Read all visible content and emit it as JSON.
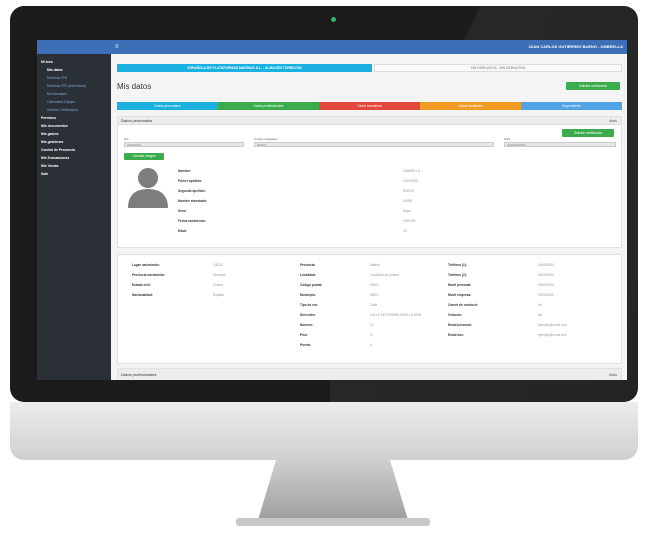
{
  "header": {
    "user": "JUAN CARLOS GUTIÉRREZ BUENO - UMBRELLA"
  },
  "sidebar": {
    "items": [
      {
        "label": "Mi área",
        "type": "head"
      },
      {
        "label": "Mis datos",
        "type": "active"
      },
      {
        "label": "Nóminas IRS",
        "type": "sub"
      },
      {
        "label": "Nóminas IRS (Administra)",
        "type": "sub"
      },
      {
        "label": "Mi calendario",
        "type": "sub"
      },
      {
        "label": "Calendario Equipo",
        "type": "sub"
      },
      {
        "label": "Solicitar Certificados",
        "type": "sub"
      },
      {
        "label": "Permisos",
        "type": "head"
      },
      {
        "label": "Mis documentos",
        "type": "head"
      },
      {
        "label": "Mis gastos",
        "type": "head"
      },
      {
        "label": "Mis gestiones",
        "type": "head"
      },
      {
        "label": "Control de Presencia",
        "type": "head"
      },
      {
        "label": "Mis Evaluaciones",
        "type": "head"
      },
      {
        "label": "Mis Ventas",
        "type": "head"
      },
      {
        "label": "Salir",
        "type": "head"
      }
    ]
  },
  "main": {
    "company": "ESPAÑOLA DE PLATAFORMAS MARINAS S.L. - ALMACÉN TORREJÓN",
    "company_alt": "SIN DERIVATIVA - SIN DERIVATIVA",
    "title": "Mis datos",
    "cert_button": "Solicitar certificados",
    "tabs": [
      {
        "label": "Datos personales",
        "color": "#1ab0e0"
      },
      {
        "label": "Datos profesionales",
        "color": "#3aac4e"
      },
      {
        "label": "Datos bancarios",
        "color": "#e4473b"
      },
      {
        "label": "Datos familiares",
        "color": "#f39c24"
      },
      {
        "label": "Seguimiento",
        "color": "#4fa3e6"
      }
    ],
    "panel1": {
      "title": "Datos personales",
      "back": "Atrás",
      "cert_button": "Solicitar certificados",
      "nif_label": "NIF",
      "nif_value": "00000000Z",
      "code_label": "Código trabajador",
      "code_value": "000000",
      "ss_label": "NSS",
      "ss_value": "000000000000",
      "change_image": "Cambiar imagen",
      "fields": [
        {
          "k": "Nombre:",
          "v": "UMBRELLA"
        },
        {
          "k": "Primer apellido:",
          "v": "CASTAÑO"
        },
        {
          "k": "Segundo apellido:",
          "v": "BUENO"
        },
        {
          "k": "Nombre abreviado:",
          "v": "UMBR"
        },
        {
          "k": "Sexo:",
          "v": "Mujer"
        },
        {
          "k": "Fecha nacimiento:",
          "v": "00/00/00"
        },
        {
          "k": "Edad:",
          "v": "43"
        }
      ]
    },
    "details": {
      "col1": [
        {
          "k": "Lugar nacimiento:",
          "v": "CÁDIZ"
        },
        {
          "k": "Provincia nacimiento:",
          "v": "Granada"
        },
        {
          "k": "Estado civil:",
          "v": "Soltera"
        },
        {
          "k": "Nacionalidad:",
          "v": "España"
        }
      ],
      "col2": [
        {
          "k": "Provincia:",
          "v": "Madrid"
        },
        {
          "k": "Localidad:",
          "v": "Localidad de prueba"
        },
        {
          "k": "Código postal:",
          "v": "28001"
        },
        {
          "k": "Municipio:",
          "v": "28001"
        },
        {
          "k": "Tipo de vía:",
          "v": "Calle"
        },
        {
          "k": "Dirección:",
          "v": "CALLE DE PRUEBA PARA LA WEB"
        },
        {
          "k": "Número:",
          "v": "11"
        },
        {
          "k": "Piso:",
          "v": "11"
        },
        {
          "k": "Puerta:",
          "v": "A"
        }
      ],
      "col3": [
        {
          "k": "Teléfono (1):",
          "v": "000000000"
        },
        {
          "k": "Teléfono (2):",
          "v": "000000000"
        },
        {
          "k": "Movil personal:",
          "v": "000000000"
        },
        {
          "k": "Movil empresa:",
          "v": "000000000"
        },
        {
          "k": "Carnet de conducir:",
          "v": "No"
        },
        {
          "k": "Vehículo:",
          "v": "No"
        },
        {
          "k": "Email personal:",
          "v": "ejemplo@email.com"
        },
        {
          "k": "Email dsc:",
          "v": "ejemplo@email.com"
        }
      ]
    },
    "panel2": {
      "title": "Datos profesionales",
      "back": "Atrás"
    }
  }
}
